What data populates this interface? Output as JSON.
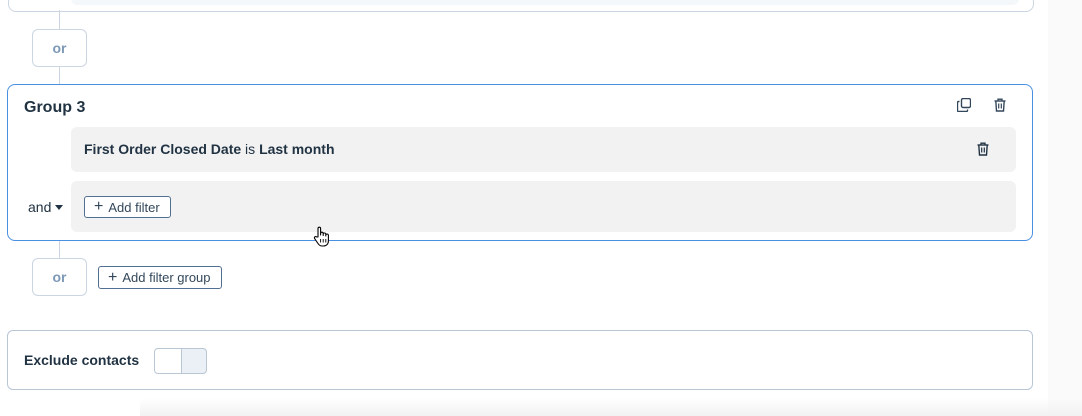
{
  "filters": {
    "or_label_top": "or",
    "group": {
      "title": "Group 3",
      "filter": {
        "property": "First Order Closed Date",
        "operator": "is",
        "value": "Last month"
      },
      "and_label": "and",
      "add_filter_label": "Add filter"
    },
    "or_label_bottom": "or",
    "add_filter_group_label": "Add filter group"
  },
  "exclude": {
    "label": "Exclude contacts",
    "enabled": false
  },
  "icons": {
    "clone": "clone-icon",
    "delete_group": "trash-icon",
    "delete_filter": "trash-icon",
    "cursor": "hand-pointer-icon"
  },
  "colors": {
    "active_border": "#4a90e2",
    "row_bg": "#f2f2f2",
    "text": "#213343"
  }
}
